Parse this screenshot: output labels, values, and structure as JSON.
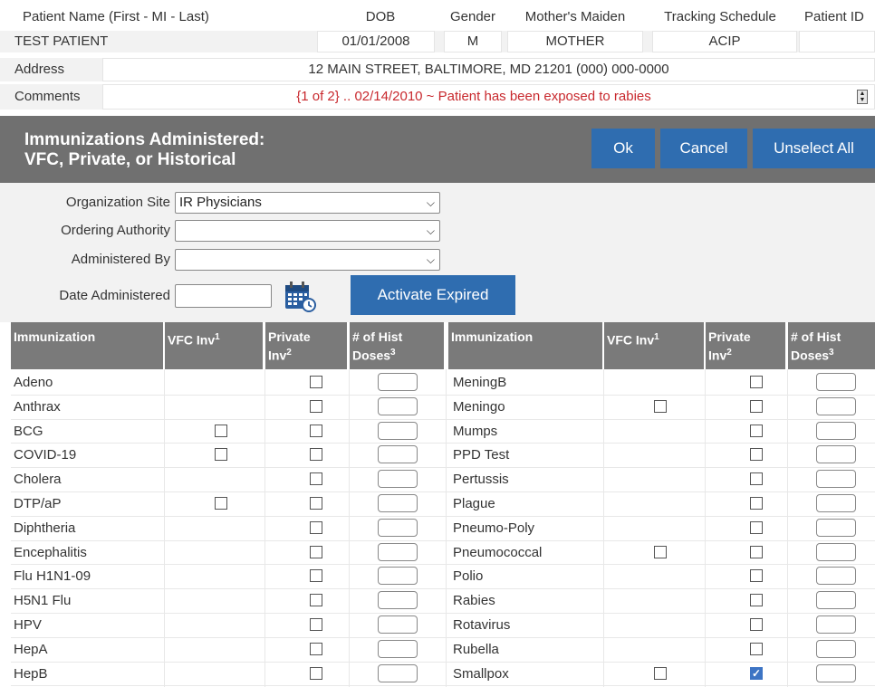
{
  "patient": {
    "headers": {
      "name": "Patient Name (First - MI - Last)",
      "dob": "DOB",
      "gender": "Gender",
      "maiden": "Mother's Maiden",
      "schedule": "Tracking Schedule",
      "id": "Patient ID"
    },
    "values": {
      "name": "TEST PATIENT",
      "dob": "01/01/2008",
      "gender": "M",
      "maiden": "MOTHER",
      "schedule": "ACIP",
      "id": ""
    },
    "address_label": "Address",
    "address": "12 MAIN STREET, BALTIMORE, MD 21201 (000) 000-0000",
    "comments_label": "Comments",
    "comments": "{1 of 2} .. 02/14/2010 ~ Patient has been exposed to rabies",
    "comment_color": "#c8282d"
  },
  "banner": {
    "title_line1": "Immunizations Administered:",
    "title_line2": "VFC, Private, or Historical",
    "ok": "Ok",
    "cancel": "Cancel",
    "unselect_all": "Unselect All",
    "button_color": "#2f6db0"
  },
  "form": {
    "org_site_label": "Organization Site",
    "org_site_value": "IR Physicians",
    "ordering_label": "Ordering Authority",
    "ordering_value": "",
    "admin_by_label": "Administered By",
    "admin_by_value": "",
    "date_label": "Date Administered",
    "date_value": "",
    "activate_expired": "Activate Expired"
  },
  "table": {
    "headers": {
      "immunization": "Immunization",
      "vfc": "VFC Inv",
      "vfc_sup": "1",
      "private_l1": "Private",
      "private_l2": "Inv",
      "private_sup": "2",
      "hist_l1": "# of Hist",
      "hist_l2": "Doses",
      "hist_sup": "3"
    },
    "left": [
      {
        "name": "Adeno",
        "vfc": null,
        "private": false
      },
      {
        "name": "Anthrax",
        "vfc": null,
        "private": false
      },
      {
        "name": "BCG",
        "vfc": false,
        "private": false
      },
      {
        "name": "COVID-19",
        "vfc": false,
        "private": false
      },
      {
        "name": "Cholera",
        "vfc": null,
        "private": false
      },
      {
        "name": "DTP/aP",
        "vfc": false,
        "private": false
      },
      {
        "name": "Diphtheria",
        "vfc": null,
        "private": false
      },
      {
        "name": "Encephalitis",
        "vfc": null,
        "private": false
      },
      {
        "name": "Flu H1N1-09",
        "vfc": null,
        "private": false
      },
      {
        "name": "H5N1 Flu",
        "vfc": null,
        "private": false
      },
      {
        "name": "HPV",
        "vfc": null,
        "private": false
      },
      {
        "name": "HepA",
        "vfc": null,
        "private": false
      },
      {
        "name": "HepB",
        "vfc": null,
        "private": false
      }
    ],
    "right": [
      {
        "name": "MeningB",
        "vfc": null,
        "private": false
      },
      {
        "name": "Meningo",
        "vfc": false,
        "private": false
      },
      {
        "name": "Mumps",
        "vfc": null,
        "private": false
      },
      {
        "name": "PPD Test",
        "vfc": null,
        "private": false
      },
      {
        "name": "Pertussis",
        "vfc": null,
        "private": false
      },
      {
        "name": "Plague",
        "vfc": null,
        "private": false
      },
      {
        "name": "Pneumo-Poly",
        "vfc": null,
        "private": false
      },
      {
        "name": "Pneumococcal",
        "vfc": false,
        "private": false
      },
      {
        "name": "Polio",
        "vfc": null,
        "private": false
      },
      {
        "name": "Rabies",
        "vfc": null,
        "private": false
      },
      {
        "name": "Rotavirus",
        "vfc": null,
        "private": false
      },
      {
        "name": "Rubella",
        "vfc": null,
        "private": false
      },
      {
        "name": "Smallpox",
        "vfc": false,
        "private": true
      }
    ]
  }
}
